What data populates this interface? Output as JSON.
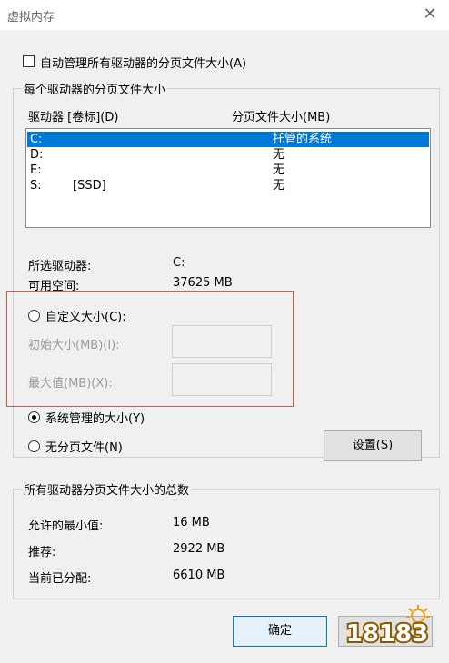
{
  "window": {
    "title": "虚拟内存",
    "close_glyph": "✕"
  },
  "auto_manage": {
    "label": "自动管理所有驱动器的分页文件大小(A)",
    "checked": false
  },
  "drives_group": {
    "label": "每个驱动器的分页文件大小",
    "col_drive": "驱动器 [卷标](D)",
    "col_size": "分页文件大小(MB)",
    "rows": [
      {
        "drive": "C:",
        "volume": "",
        "size": "托管的系统",
        "selected": true
      },
      {
        "drive": "D:",
        "volume": "",
        "size": "无",
        "selected": false
      },
      {
        "drive": "E:",
        "volume": "",
        "size": "无",
        "selected": false
      },
      {
        "drive": "S:",
        "volume": "[SSD]",
        "size": "无",
        "selected": false
      }
    ]
  },
  "selected_drive": {
    "label": "所选驱动器:",
    "value": "C:"
  },
  "free_space": {
    "label": "可用空间:",
    "value": "37625 MB"
  },
  "options": {
    "custom": "自定义大小(C):",
    "initial_label": "初始大小(MB)(I):",
    "max_label": "最大值(MB)(X):",
    "system_managed": "系统管理的大小(Y)",
    "no_paging": "无分页文件(N)",
    "selected": "system_managed"
  },
  "set_button": "设置(S)",
  "totals_group": {
    "label": "所有驱动器分页文件大小的总数",
    "min_label": "允许的最小值:",
    "min_value": "16 MB",
    "recommended_label": "推荐:",
    "recommended_value": "2922 MB",
    "allocated_label": "当前已分配:",
    "allocated_value": "6610 MB"
  },
  "ok_button": "确定",
  "watermark": "18183",
  "colors": {
    "selection": "#0078d7",
    "highlight_box": "#d9534f",
    "logo_orange": "#f39c12"
  }
}
